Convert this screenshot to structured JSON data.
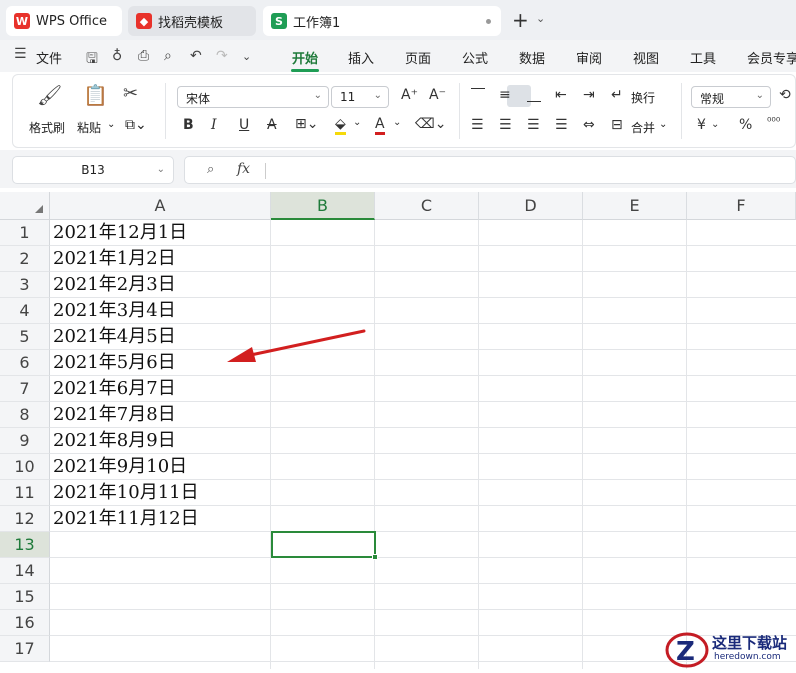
{
  "tabs": {
    "wps": "WPS Office",
    "template": "找稻壳模板",
    "workbook": "工作簿1"
  },
  "menu": {
    "file": "文件",
    "items": [
      "开始",
      "插入",
      "页面",
      "公式",
      "数据",
      "审阅",
      "视图",
      "工具",
      "会员专享"
    ],
    "active": "开始"
  },
  "ribbon": {
    "format_painter": "格式刷",
    "paste": "粘贴",
    "font_name": "宋体",
    "font_size": "11",
    "wrap": "换行",
    "merge": "合并",
    "number_format": "常规",
    "currency_symbol": "¥",
    "percent": "%"
  },
  "formula_bar": {
    "name_box": "B13",
    "fx": "fx"
  },
  "sheet": {
    "columns": [
      "A",
      "B",
      "C",
      "D",
      "E",
      "F"
    ],
    "active_column": "B",
    "active_row": 13,
    "rows": [
      {
        "n": "1",
        "a": "2021年12月1日"
      },
      {
        "n": "2",
        "a": "2021年1月2日"
      },
      {
        "n": "3",
        "a": "2021年2月3日"
      },
      {
        "n": "4",
        "a": "2021年3月4日"
      },
      {
        "n": "5",
        "a": "2021年4月5日"
      },
      {
        "n": "6",
        "a": "2021年5月6日"
      },
      {
        "n": "7",
        "a": "2021年6月7日"
      },
      {
        "n": "8",
        "a": "2021年7月8日"
      },
      {
        "n": "9",
        "a": "2021年8月9日"
      },
      {
        "n": "10",
        "a": "2021年9月10日"
      },
      {
        "n": "11",
        "a": "2021年10月11日"
      },
      {
        "n": "12",
        "a": "2021年11月12日"
      },
      {
        "n": "13",
        "a": ""
      },
      {
        "n": "14",
        "a": ""
      },
      {
        "n": "15",
        "a": ""
      },
      {
        "n": "16",
        "a": ""
      },
      {
        "n": "17",
        "a": ""
      }
    ]
  },
  "watermark": {
    "name": "这里下载站",
    "url": "heredown.com"
  },
  "colors": {
    "accent": "#1f7a3a",
    "selection": "#2a8a3a",
    "arrow": "#d21f1f"
  }
}
